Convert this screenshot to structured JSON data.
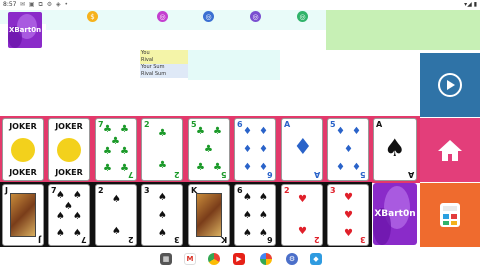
{
  "status": {
    "time": "8:57",
    "icons": "✉ ▣ ⧉ ⚙ ◈ •",
    "right": "▾◢ ▮"
  },
  "top_icons": [
    "coin-icon",
    "poker-chip-icon",
    "poker-chip-icon",
    "poker-chip-icon",
    "poker-chip-icon"
  ],
  "logo_text": "XBart0n",
  "score": {
    "you": "You",
    "rival": "Rival",
    "your_sum": "Your Sum",
    "rival_sum": "Rival Sum"
  },
  "row1": [
    {
      "kind": "joker",
      "label": "JOKER"
    },
    {
      "kind": "joker",
      "label": "JOKER"
    },
    {
      "kind": "number",
      "rank": "7",
      "suit": "♣",
      "color": "green"
    },
    {
      "kind": "number",
      "rank": "2",
      "suit": "♣",
      "color": "green"
    },
    {
      "kind": "number",
      "rank": "5",
      "suit": "♣",
      "color": "green"
    },
    {
      "kind": "number",
      "rank": "6",
      "suit": "♦",
      "color": "blue"
    },
    {
      "kind": "number",
      "rank": "A",
      "suit": "♦",
      "color": "blue"
    },
    {
      "kind": "number",
      "rank": "5",
      "suit": "♦",
      "color": "blue"
    },
    {
      "kind": "number",
      "rank": "A",
      "suit": "♠",
      "color": "black"
    }
  ],
  "row2": [
    {
      "kind": "face",
      "rank": "J",
      "suit": "♠",
      "color": "black"
    },
    {
      "kind": "number",
      "rank": "7",
      "suit": "♠",
      "color": "black"
    },
    {
      "kind": "number",
      "rank": "2",
      "suit": "♠",
      "color": "black"
    },
    {
      "kind": "number",
      "rank": "3",
      "suit": "♠",
      "color": "black"
    },
    {
      "kind": "face",
      "rank": "K",
      "suit": "♠",
      "color": "black"
    },
    {
      "kind": "number",
      "rank": "6",
      "suit": "♠",
      "color": "black"
    },
    {
      "kind": "number",
      "rank": "2",
      "suit": "♥",
      "color": "red"
    },
    {
      "kind": "number",
      "rank": "3",
      "suit": "♥",
      "color": "red"
    }
  ],
  "nav": [
    "grid-icon",
    "gmail-icon",
    "chrome-icon",
    "youtube-icon",
    "photos-icon",
    "settings-icon",
    "app-icon"
  ],
  "colors": {
    "play": "#2f73a7",
    "home": "#e33e7a",
    "calc": "#ef6b2e",
    "row1_bg": "#e3396b",
    "green_panel": "#c7f0b5"
  }
}
